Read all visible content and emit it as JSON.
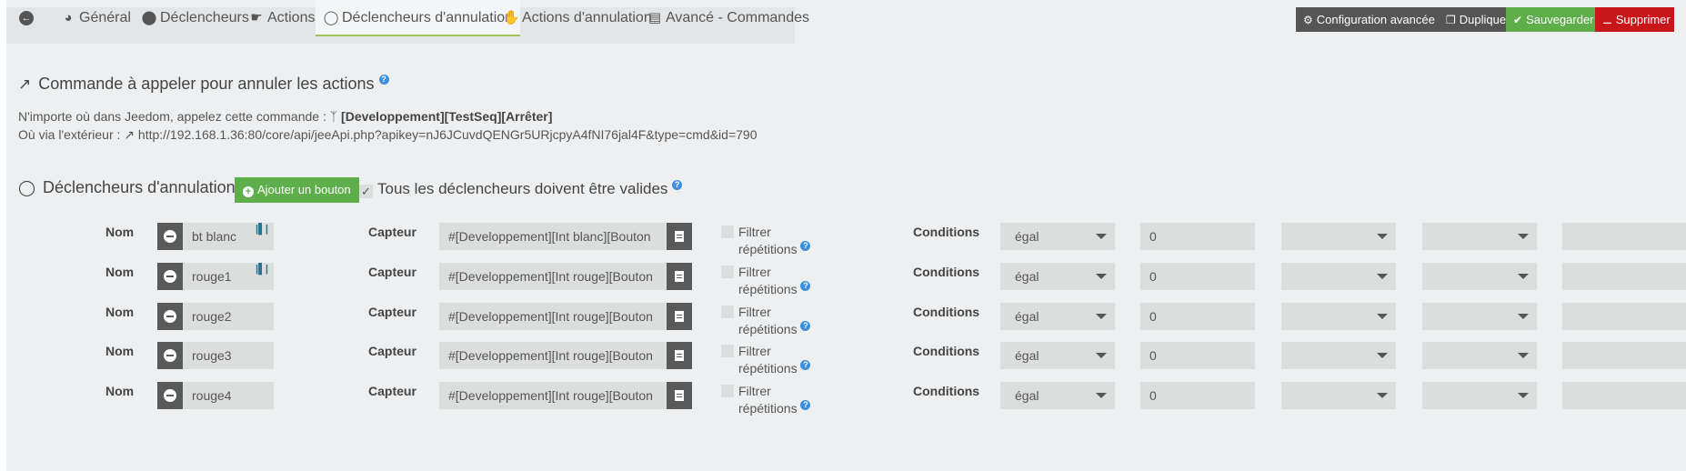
{
  "tabs": [
    {
      "label": "",
      "icon": "arrow-circle-left-icon"
    },
    {
      "label": "Général",
      "icon": "tachometer-icon"
    },
    {
      "label": "Déclencheurs",
      "icon": "toggle-icon"
    },
    {
      "label": "Actions",
      "icon": "hand-point-icon"
    },
    {
      "label": "Déclencheurs d'annulation",
      "icon": "toggle-off-icon",
      "active": true
    },
    {
      "label": "Actions d'annulation",
      "icon": "hand-icon"
    },
    {
      "label": "Avancé - Commandes",
      "icon": "list-alt-icon"
    }
  ],
  "toolbar": {
    "advanced_config": "Configuration avancée",
    "duplicate": "Dupliquer",
    "save": "Sauvegarder",
    "delete": "Supprimer"
  },
  "command_section": {
    "title": "Commande à appeler pour annuler les actions",
    "anywhere_label": "N'importe où dans Jeedom, appelez cette commande :",
    "command_name": "[Developpement][TestSeq][Arrêter]",
    "external_label": "Où via l'extérieur :",
    "external_url": "http://192.168.1.36:80/core/api/jeeApi.php?apikey=nJ6JCuvdQENGr5URjcpyA4fNI76jal4F&type=cmd&id=790"
  },
  "triggers_section": {
    "title": "Déclencheurs d'annulation",
    "add_button": "Ajouter un bouton",
    "all_valid_label": "Tous les déclencheurs doivent être valides",
    "all_valid_checked": true
  },
  "row_labels": {
    "name": "Nom",
    "sensor": "Capteur",
    "filter": "Filtrer répétitions",
    "filter_line1": "Filtrer",
    "filter_line2": "répétitions",
    "conditions": "Conditions"
  },
  "triggers": [
    {
      "name": "bt blanc",
      "sensor": "#[Developpement][Int blanc][Bouton",
      "operator": "égal",
      "value": "0",
      "has_icon": true
    },
    {
      "name": "rouge1",
      "sensor": "#[Developpement][Int rouge][Bouton",
      "operator": "égal",
      "value": "0",
      "has_icon": true
    },
    {
      "name": "rouge2",
      "sensor": "#[Developpement][Int rouge][Bouton",
      "operator": "égal",
      "value": "0",
      "has_icon": false
    },
    {
      "name": "rouge3",
      "sensor": "#[Developpement][Int rouge][Bouton",
      "operator": "égal",
      "value": "0",
      "has_icon": false
    },
    {
      "name": "rouge4",
      "sensor": "#[Developpement][Int rouge][Bouton",
      "operator": "égal",
      "value": "0",
      "has_icon": false
    }
  ],
  "colors": {
    "success": "#5fae4c",
    "danger": "#c8171a",
    "dark": "#555555",
    "active_tab_underline": "#9ec15a",
    "help": "#3d8fdc"
  }
}
